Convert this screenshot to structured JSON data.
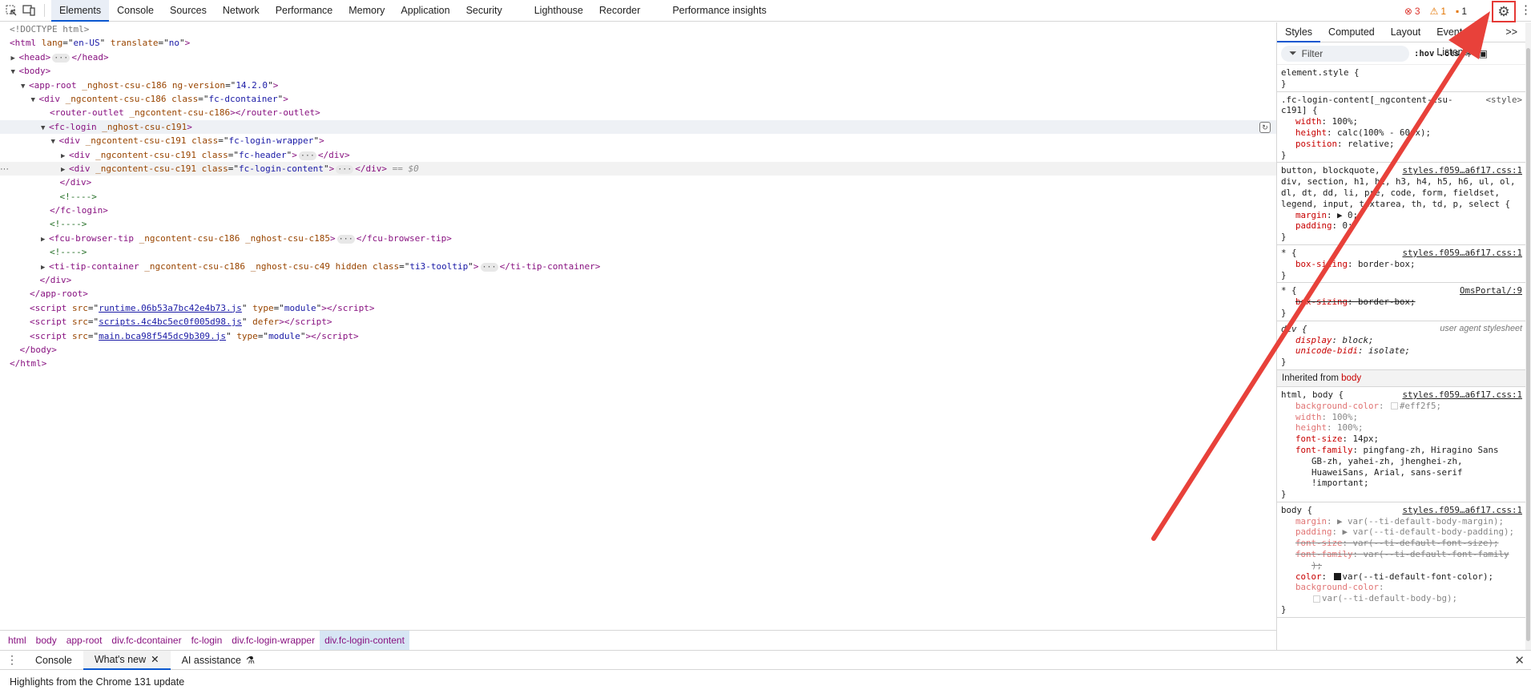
{
  "toolbar": {
    "tabs": [
      "Elements",
      "Console",
      "Sources",
      "Network",
      "Performance",
      "Memory",
      "Application",
      "Security",
      "Lighthouse",
      "Recorder",
      "Performance insights"
    ],
    "errors": "3",
    "warnings": "1",
    "issues": "1"
  },
  "dom": {
    "lines": [
      {
        "indent": 0,
        "html": "<span class='gr'>&lt;!DOCTYPE html&gt;</span>"
      },
      {
        "indent": 0,
        "html": "<span class='tag'>&lt;html</span> <span class='an'>lang</span>=\"<span class='av'>en-US</span>\" <span class='an'>translate</span>=\"<span class='av'>no</span>\"<span class='tag'>&gt;</span>"
      },
      {
        "indent": 1,
        "tri": "▶",
        "html": "<span class='tag'>&lt;head&gt;</span><span class='ell'>···</span><span class='tag'>&lt;/head&gt;</span>"
      },
      {
        "indent": 1,
        "tri": "▼",
        "html": "<span class='tag'>&lt;body&gt;</span>"
      },
      {
        "indent": 2,
        "tri": "▼",
        "html": "<span class='tag'>&lt;app-root</span> <span class='an'>_nghost-csu-c186</span> <span class='an'>ng-version</span>=\"<span class='av'>14.2.0</span>\"<span class='tag'>&gt;</span>"
      },
      {
        "indent": 3,
        "tri": "▼",
        "html": "<span class='tag'>&lt;div</span> <span class='an'>_ngcontent-csu-c186</span> <span class='an'>class</span>=\"<span class='av'>fc-dcontainer</span>\"<span class='tag'>&gt;</span>"
      },
      {
        "indent": 4,
        "html": "<span class='tag'>&lt;router-outlet</span> <span class='an'>_ngcontent-csu-c186</span><span class='tag'>&gt;&lt;/router-outlet&gt;</span>"
      },
      {
        "indent": 4,
        "tri": "▼",
        "hov": true,
        "html": "<span class='tag'>&lt;fc-login</span> <span class='an'>_nghost-csu-c191</span><span class='tag'>&gt;</span>"
      },
      {
        "indent": 5,
        "tri": "▼",
        "html": "<span class='tag'>&lt;div</span> <span class='an'>_ngcontent-csu-c191</span> <span class='an'>class</span>=\"<span class='av'>fc-login-wrapper</span>\"<span class='tag'>&gt;</span>"
      },
      {
        "indent": 6,
        "tri": "▶",
        "html": "<span class='tag'>&lt;div</span> <span class='an'>_ngcontent-csu-c191</span> <span class='an'>class</span>=\"<span class='av'>fc-header</span>\"<span class='tag'>&gt;</span><span class='ell'>···</span><span class='tag'>&lt;/div&gt;</span>"
      },
      {
        "indent": 6,
        "tri": "▶",
        "sel": true,
        "html": "<span class='tag'>&lt;div</span> <span class='an'>_ngcontent-csu-c191</span> <span class='an'>class</span>=\"<span class='av'>fc-login-content</span>\"<span class='tag'>&gt;</span><span class='ell'>···</span><span class='tag'>&lt;/div&gt;</span> <span class='eq'>== $0</span>"
      },
      {
        "indent": 5,
        "html": "<span class='tag'>&lt;/div&gt;</span>"
      },
      {
        "indent": 5,
        "html": "<span class='cm'>&lt;!----&gt;</span>"
      },
      {
        "indent": 4,
        "html": "<span class='tag'>&lt;/fc-login&gt;</span>"
      },
      {
        "indent": 4,
        "html": "<span class='cm'>&lt;!----&gt;</span>"
      },
      {
        "indent": 4,
        "tri": "▶",
        "html": "<span class='tag'>&lt;fcu-browser-tip</span> <span class='an'>_ngcontent-csu-c186</span> <span class='an'>_nghost-csu-c185</span><span class='tag'>&gt;</span><span class='ell'>···</span><span class='tag'>&lt;/fcu-browser-tip&gt;</span>"
      },
      {
        "indent": 4,
        "html": "<span class='cm'>&lt;!----&gt;</span>"
      },
      {
        "indent": 4,
        "tri": "▶",
        "html": "<span class='tag'>&lt;ti-tip-container</span> <span class='an'>_ngcontent-csu-c186</span> <span class='an'>_nghost-csu-c49</span> <span class='an'>hidden</span> <span class='an'>class</span>=\"<span class='av'>ti3-tooltip</span>\"<span class='tag'>&gt;</span><span class='ell'>···</span><span class='tag'>&lt;/ti-tip-container&gt;</span>"
      },
      {
        "indent": 3,
        "html": "<span class='tag'>&lt;/div&gt;</span>"
      },
      {
        "indent": 2,
        "html": "<span class='tag'>&lt;/app-root&gt;</span>"
      },
      {
        "indent": 2,
        "html": "<span class='tag'>&lt;script</span> <span class='an'>src</span>=\"<span class='link'>runtime.06b53a7bc42e4b73.js</span>\" <span class='an'>type</span>=\"<span class='av'>module</span>\"<span class='tag'>&gt;&lt;/script&gt;</span>"
      },
      {
        "indent": 2,
        "html": "<span class='tag'>&lt;script</span> <span class='an'>src</span>=\"<span class='link'>scripts.4c4bc5ec0f005d98.js</span>\" <span class='an'>defer</span><span class='tag'>&gt;&lt;/script&gt;</span>"
      },
      {
        "indent": 2,
        "html": "<span class='tag'>&lt;script</span> <span class='an'>src</span>=\"<span class='link'>main.bca98f545dc9b309.js</span>\" <span class='an'>type</span>=\"<span class='av'>module</span>\"<span class='tag'>&gt;&lt;/script&gt;</span>"
      },
      {
        "indent": 1,
        "html": "<span class='tag'>&lt;/body&gt;</span>"
      },
      {
        "indent": 0,
        "html": "<span class='tag'>&lt;/html&gt;</span>"
      }
    ]
  },
  "breadcrumbs": [
    "html",
    "body",
    "app-root",
    "div.fc-dcontainer",
    "fc-login",
    "div.fc-login-wrapper",
    "div.fc-login-content"
  ],
  "styles": {
    "tabs": [
      "Styles",
      "Computed",
      "Layout",
      "Event Listeners"
    ],
    "more": ">>",
    "filter_placeholder": "Filter",
    "hov": ":hov",
    "cls": ".cls",
    "inherited_label": "Inherited from",
    "inherited_from": "body"
  },
  "drawer": {
    "tabs": [
      "Console",
      "What's new",
      "AI assistance"
    ],
    "content": "Highlights from the Chrome 131 update"
  }
}
